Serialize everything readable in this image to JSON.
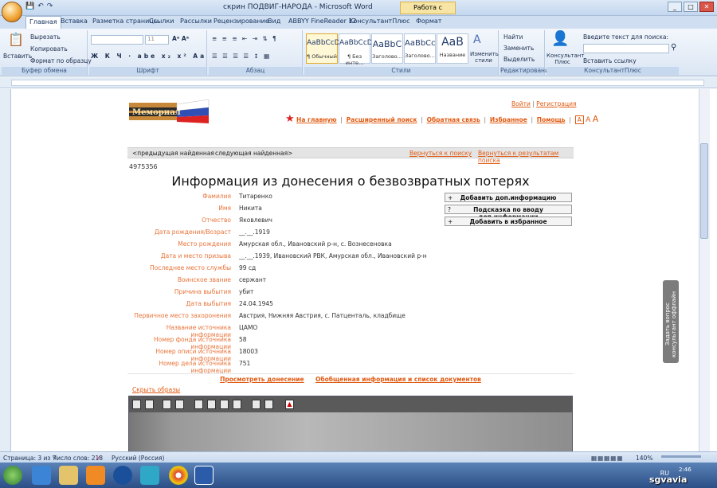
{
  "window": {
    "title": "скрин ПОДВИГ-НАРОДА - Microsoft Word",
    "context_tab": "Работа с рисунками"
  },
  "ribbon_tabs": [
    "Главная",
    "Вставка",
    "Разметка страницы",
    "Ссылки",
    "Рассылки",
    "Рецензирование",
    "Вид",
    "ABBYY FineReader 12",
    "КонсультантПлюс",
    "Формат"
  ],
  "clipboard": {
    "paste": "Вставить",
    "cut": "Вырезать",
    "copy": "Копировать",
    "format": "Формат по образцу",
    "label": "Буфер обмена"
  },
  "font": {
    "size": "11",
    "label": "Шрифт"
  },
  "paragraph": {
    "label": "Абзац"
  },
  "styles": {
    "items": [
      {
        "preview": "AaBbCcDc",
        "name": "¶ Обычный"
      },
      {
        "preview": "AaBbCcDc",
        "name": "¶ Без инте..."
      },
      {
        "preview": "AaBbC",
        "name": "Заголово..."
      },
      {
        "preview": "AaBbCc",
        "name": "Заголово..."
      },
      {
        "preview": "AaB",
        "name": "Название"
      }
    ],
    "change": "Изменить стили",
    "label": "Стили"
  },
  "editing": {
    "find": "Найти",
    "replace": "Заменить",
    "select": "Выделить",
    "label": "Редактирование"
  },
  "consultant": {
    "name": "Консультант Плюс",
    "search_label": "Введите текст для поиска:",
    "insert_link": "Вставить ссылку",
    "label": "КонсультантПлюс"
  },
  "page": {
    "auth": {
      "login": "Войти",
      "sep": "|",
      "register": "Регистрация"
    },
    "nav": [
      "На главную",
      "Расширенный поиск",
      "Обратная связь",
      "Избранное",
      "Помощь"
    ],
    "font_sizes": [
      "A",
      "A",
      "A"
    ],
    "navbar": {
      "prev": "<предыдущая найденная",
      "next": "следующая найденная>",
      "back_search": "Вернуться к поиску",
      "back_results": "Вернуться к результатам поиска"
    },
    "record_id": "4975356",
    "heading": "Информация из донесения о безвозвратных потерях",
    "fields": [
      {
        "label": "Фамилия",
        "value": "Титаренко"
      },
      {
        "label": "Имя",
        "value": "Никита"
      },
      {
        "label": "Отчество",
        "value": "Яковлевич"
      },
      {
        "label": "Дата рождения/Возраст",
        "value": "__.__.1919"
      },
      {
        "label": "Место рождения",
        "value": "Амурская обл., Ивановский р-н, с. Вознесеновка"
      },
      {
        "label": "Дата и место призыва",
        "value": "__.__.1939, Ивановский РВК, Амурская обл., Ивановский р-н"
      },
      {
        "label": "Последнее место службы",
        "value": "99 сд"
      },
      {
        "label": "Воинское звание",
        "value": "сержант"
      },
      {
        "label": "Причина выбытия",
        "value": "убит"
      },
      {
        "label": "Дата выбытия",
        "value": "24.04.1945"
      },
      {
        "label": "Первичное место захоронения",
        "value": "Австрия, Нижняя Австрия, с. Патценталь, кладбище"
      },
      {
        "label": "Название источника информации",
        "value": "ЦАМО"
      },
      {
        "label": "Номер фонда источника информации",
        "value": "58"
      },
      {
        "label": "Номер описи источника информации",
        "value": "18003"
      },
      {
        "label": "Номер дела источника информации",
        "value": "751"
      }
    ],
    "actions": [
      {
        "prefix": "+",
        "label": "Добавить доп.информацию"
      },
      {
        "prefix": "?",
        "label": "Подсказка по вводу доп.информации"
      },
      {
        "prefix": "+",
        "label": "Добавить в избранное"
      }
    ],
    "bottom_links": {
      "view": "Просмотреть донесение",
      "summary": "Обобщенная информация и список документов"
    },
    "hide_images": "Скрыть образы"
  },
  "side_panel": "Задать вопрос консультант оффлайн",
  "status": {
    "page": "Страница: 3 из 7",
    "words": "Число слов: 218",
    "lang": "Русский (Россия)",
    "zoom": "140%"
  },
  "taskbar": {
    "lang": "RU",
    "time": "2:46"
  },
  "watermark": "sgvavia"
}
